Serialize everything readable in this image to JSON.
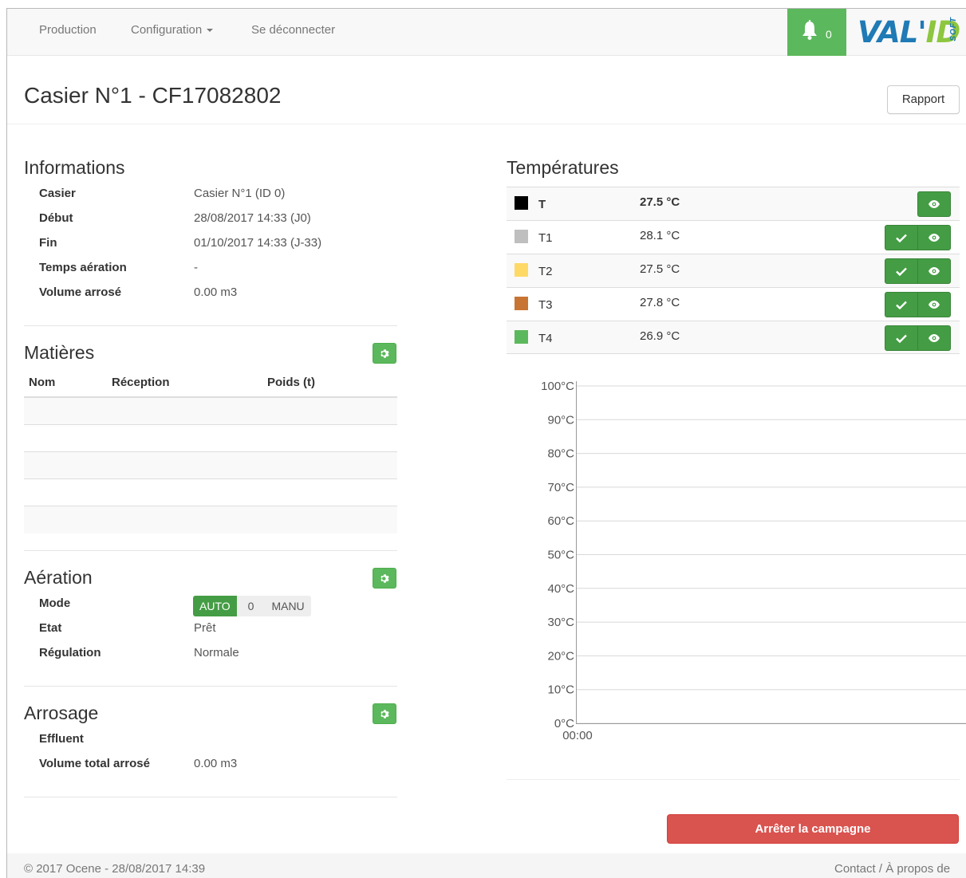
{
  "navbar": {
    "items": [
      "Production",
      "Configuration",
      "Se déconnecter"
    ],
    "notification_count": "0",
    "logo_main": "VAL'",
    "logo_accent": "ID",
    "logo_sub": "SOFT"
  },
  "header": {
    "title": "Casier N°1 - CF17082802",
    "report_button": "Rapport"
  },
  "informations": {
    "title": "Informations",
    "rows": [
      {
        "label": "Casier",
        "value": "Casier N°1 (ID 0)"
      },
      {
        "label": "Début",
        "value": "28/08/2017 14:33 (J0)"
      },
      {
        "label": "Fin",
        "value": "01/10/2017 14:33 (J-33)"
      },
      {
        "label": "Temps aération",
        "value": "-"
      },
      {
        "label": "Volume arrosé",
        "value": "0.00 m3"
      }
    ]
  },
  "matieres": {
    "title": "Matières",
    "columns": [
      "Nom",
      "Réception",
      "Poids (t)"
    ],
    "rows": []
  },
  "aeration": {
    "title": "Aération",
    "mode_label": "Mode",
    "mode_options": [
      "AUTO",
      "0",
      "MANU"
    ],
    "mode_selected": "AUTO",
    "etat_label": "Etat",
    "etat_value": "Prêt",
    "regulation_label": "Régulation",
    "regulation_value": "Normale"
  },
  "arrosage": {
    "title": "Arrosage",
    "effluent_label": "Effluent",
    "effluent_value": "",
    "volume_label": "Volume total arrosé",
    "volume_value": "0.00 m3"
  },
  "temperatures": {
    "title": "Températures",
    "sensors": [
      {
        "name": "T",
        "value": "27.5 °C",
        "color": "#000000"
      },
      {
        "name": "T1",
        "value": "28.1 °C",
        "color": "#bfbfbf"
      },
      {
        "name": "T2",
        "value": "27.5 °C",
        "color": "#ffd966"
      },
      {
        "name": "T3",
        "value": "27.8 °C",
        "color": "#c87533"
      },
      {
        "name": "T4",
        "value": "26.9 °C",
        "color": "#5cb85c"
      }
    ]
  },
  "chart_data": {
    "type": "line",
    "title": "",
    "xlabel": "",
    "ylabel": "",
    "y_ticks": [
      "100°C",
      "90°C",
      "80°C",
      "70°C",
      "60°C",
      "50°C",
      "40°C",
      "30°C",
      "20°C",
      "10°C",
      "0°C"
    ],
    "x_ticks": [
      "00:00"
    ],
    "ylim": [
      0,
      100
    ],
    "grid": true,
    "series": []
  },
  "actions": {
    "stop_campaign": "Arrêter la campagne"
  },
  "footer": {
    "left": "© 2017 Ocene - 28/08/2017 14:39",
    "right": "Contact / À propos de"
  }
}
